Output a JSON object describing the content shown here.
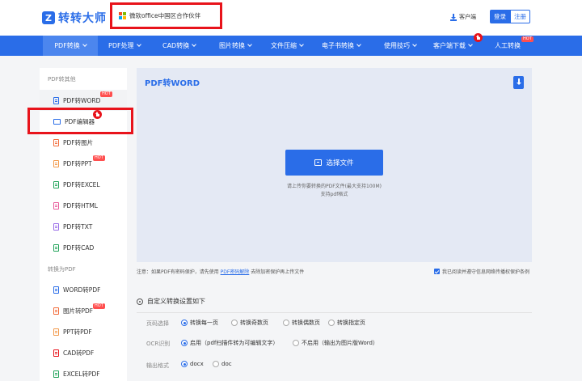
{
  "header": {
    "logo_text": "转转大师",
    "logo_mark": "Z",
    "partner_text": "微软office中国区合作伙伴",
    "client_link": "客户端",
    "login_label": "登录",
    "register_label": "注册"
  },
  "nav": {
    "items": [
      {
        "label": "PDF转换",
        "has_caret": true
      },
      {
        "label": "PDF处理",
        "has_caret": true
      },
      {
        "label": "CAD转换",
        "has_caret": true
      },
      {
        "label": "图片转换",
        "has_caret": true
      },
      {
        "label": "文件压缩",
        "has_caret": true
      },
      {
        "label": "电子书转换",
        "has_caret": true
      },
      {
        "label": "使用技巧",
        "has_caret": true
      },
      {
        "label": "客户端下载",
        "has_caret": true
      },
      {
        "label": "人工转换",
        "has_caret": false
      }
    ],
    "hot_badge": "HOT"
  },
  "sidebar": {
    "section1": "PDF转其他",
    "items1": [
      {
        "label": "PDF转WORD",
        "badge": "HOT",
        "icon": "doc-icon",
        "color": "#2a6de8"
      },
      {
        "label": "PDF编辑器",
        "badge": "",
        "icon": "screen-icon",
        "color": "#2a6de8"
      },
      {
        "label": "PDF转图片",
        "badge": "",
        "icon": "doc-icon",
        "color": "#f26b3a"
      },
      {
        "label": "PDF转PPT",
        "badge": "HOT",
        "icon": "doc-icon",
        "color": "#f2994a"
      },
      {
        "label": "PDF转EXCEL",
        "badge": "",
        "icon": "doc-icon",
        "color": "#22a35a"
      },
      {
        "label": "PDF转HTML",
        "badge": "",
        "icon": "doc-icon",
        "color": "#e85a9a"
      },
      {
        "label": "PDF转TXT",
        "badge": "",
        "icon": "doc-icon",
        "color": "#9a6de8"
      },
      {
        "label": "PDF转CAD",
        "badge": "",
        "icon": "doc-icon",
        "color": "#22a35a"
      }
    ],
    "section2": "转换为PDF",
    "items2": [
      {
        "label": "WORD转PDF",
        "badge": "",
        "icon": "doc-icon",
        "color": "#2a6de8"
      },
      {
        "label": "图片转PDF",
        "badge": "HOT",
        "icon": "doc-icon",
        "color": "#f26b3a"
      },
      {
        "label": "PPT转PDF",
        "badge": "",
        "icon": "doc-icon",
        "color": "#f2994a"
      },
      {
        "label": "CAD转PDF",
        "badge": "",
        "icon": "doc-icon",
        "color": "#e8131b"
      },
      {
        "label": "EXCEL转PDF",
        "badge": "",
        "icon": "doc-icon",
        "color": "#22a35a"
      }
    ]
  },
  "main": {
    "title": "PDF转WORD",
    "choose_button": "选择文件",
    "hint1": "请上传你要转换的PDF文件(最大支持100M)",
    "hint2": "支持pdf格式"
  },
  "notice": {
    "prefix": "注意：如果PDF有密码保护，请先使用 ",
    "link": "PDF密码解除",
    "suffix": " 去除加密保护再上传文件",
    "agree": "我已阅读并遵守信息网络传播权保护条例"
  },
  "settings": {
    "title": "自定义转换设置如下",
    "page_label": "页码选择",
    "page_options": [
      "转换每一页",
      "转换奇数页",
      "转换偶数页",
      "转换指定页"
    ],
    "page_selected": 0,
    "ocr_label": "OCR识别",
    "ocr_options": [
      "启用（pdf扫描件转为可编辑文字）",
      "不启用（输出为图片版Word）"
    ],
    "ocr_selected": 0,
    "format_label": "输出格式",
    "format_options": [
      "docx",
      "doc"
    ],
    "format_selected": 0
  },
  "colors": {
    "accent": "#2a6de8",
    "highlight_red": "#e8131b",
    "hot_badge": "#ff4f4f"
  }
}
